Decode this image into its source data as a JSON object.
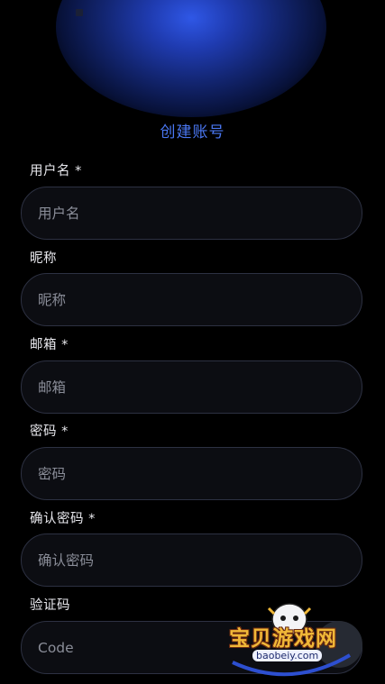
{
  "header": {
    "title": "创建账号"
  },
  "form": {
    "username": {
      "label": "用户名 *",
      "placeholder": "用户名"
    },
    "nickname": {
      "label": "昵称",
      "placeholder": "昵称"
    },
    "email": {
      "label": "邮箱 *",
      "placeholder": "邮箱"
    },
    "password": {
      "label": "密码 *",
      "placeholder": "密码"
    },
    "confirm_password": {
      "label": "确认密码 *",
      "placeholder": "确认密码"
    },
    "captcha": {
      "label": "验证码",
      "placeholder": "Code"
    }
  },
  "watermark": {
    "text": "宝贝游戏网",
    "url": "baobeiy.com"
  },
  "colors": {
    "accent": "#4a77f2",
    "background": "#000000",
    "field_border": "#2d3142"
  }
}
